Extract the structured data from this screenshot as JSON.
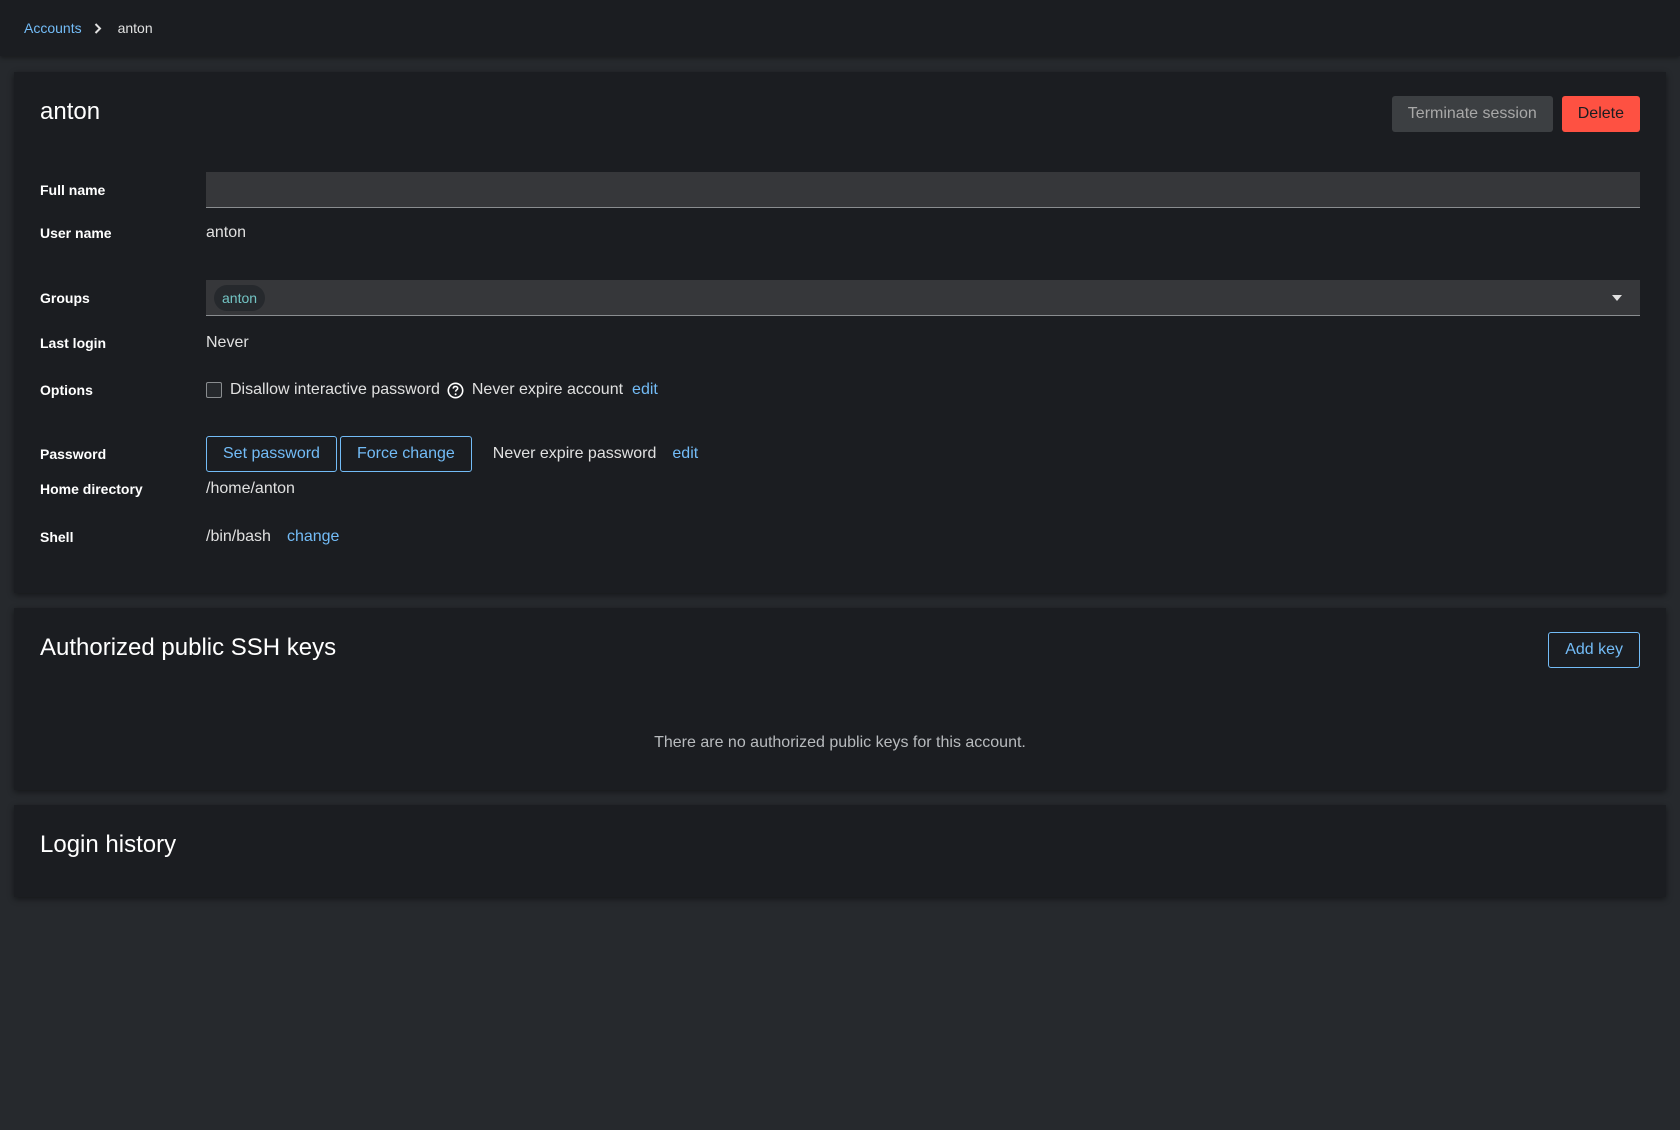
{
  "breadcrumb": {
    "parent": "Accounts",
    "current": "anton"
  },
  "account": {
    "title": "anton",
    "actions": {
      "terminate": "Terminate session",
      "delete": "Delete"
    },
    "fields": {
      "full_name_label": "Full name",
      "full_name_value": "",
      "user_name_label": "User name",
      "user_name_value": "anton",
      "groups_label": "Groups",
      "groups": [
        "anton"
      ],
      "last_login_label": "Last login",
      "last_login_value": "Never",
      "options_label": "Options",
      "disallow_password_label": "Disallow interactive password",
      "disallow_password_checked": false,
      "account_expiry": "Never expire account",
      "account_expiry_edit": "edit",
      "password_label": "Password",
      "set_password": "Set password",
      "force_change": "Force change",
      "password_expiry": "Never expire password",
      "password_expiry_edit": "edit",
      "home_label": "Home directory",
      "home_value": "/home/anton",
      "shell_label": "Shell",
      "shell_value": "/bin/bash",
      "shell_change": "change"
    }
  },
  "ssh_keys": {
    "title": "Authorized public SSH keys",
    "add_key": "Add key",
    "empty_message": "There are no authorized public keys for this account."
  },
  "login_history": {
    "title": "Login history"
  },
  "colors": {
    "link": "#73bcf7",
    "danger": "#fe5142",
    "card_bg": "#1b1d21",
    "page_bg": "#26292d"
  }
}
